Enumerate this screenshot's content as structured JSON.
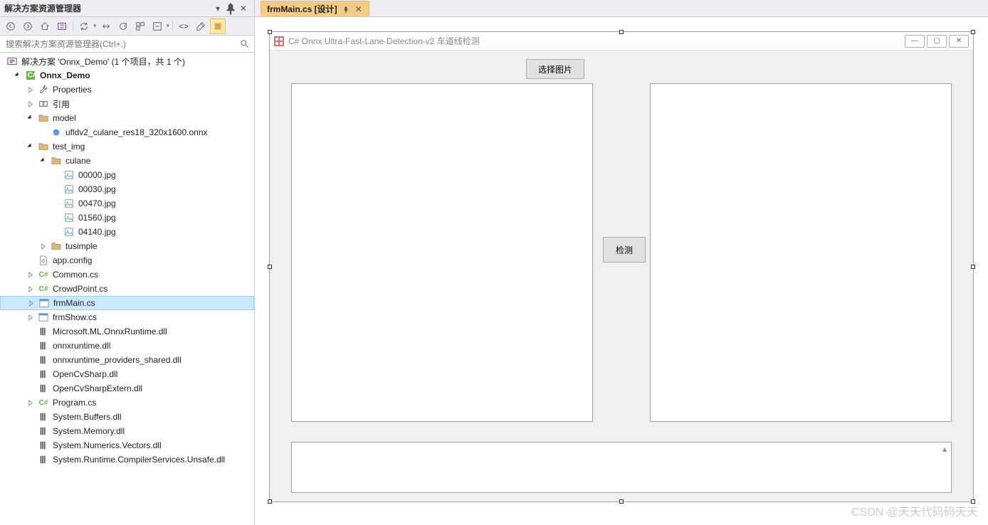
{
  "solutionExplorer": {
    "title": "解决方案资源管理器",
    "searchPlaceholder": "搜索解决方案资源管理器(Ctrl+;)",
    "tree": {
      "solution": "解决方案 'Onnx_Demo' (1 个项目，共 1 个)",
      "project": "Onnx_Demo",
      "properties": "Properties",
      "references": "引用",
      "model": "model",
      "modelFile": "ufldv2_culane_res18_320x1600.onnx",
      "testImg": "test_img",
      "culane": "culane",
      "img1": "00000.jpg",
      "img2": "00030.jpg",
      "img3": "00470.jpg",
      "img4": "01560.jpg",
      "img5": "04140.jpg",
      "tusimple": "tusimple",
      "appConfig": "app.config",
      "common": "Common.cs",
      "crowdPoint": "CrowdPoint.cs",
      "frmMain": "frmMain.cs",
      "frmShow": "frmShow.cs",
      "dll1": "Microsoft.ML.OnnxRuntime.dll",
      "dll2": "onnxruntime.dll",
      "dll3": "onnxruntime_providers_shared.dll",
      "dll4": "OpenCvSharp.dll",
      "dll5": "OpenCvSharpExtern.dll",
      "program": "Program.cs",
      "dll6": "System.Buffers.dll",
      "dll7": "System.Memory.dll",
      "dll8": "System.Numerics.Vectors.dll",
      "dll9": "System.Runtime.CompilerServices.Unsafe.dll"
    }
  },
  "tab": {
    "label": "frmMain.cs [设计]"
  },
  "form": {
    "title": "C# Onnx Ultra-Fast-Lane-Detection-v2 车道线检测",
    "selectImage": "选择图片",
    "detect": "检测"
  },
  "watermark": "CSDN @天天代码码天天"
}
